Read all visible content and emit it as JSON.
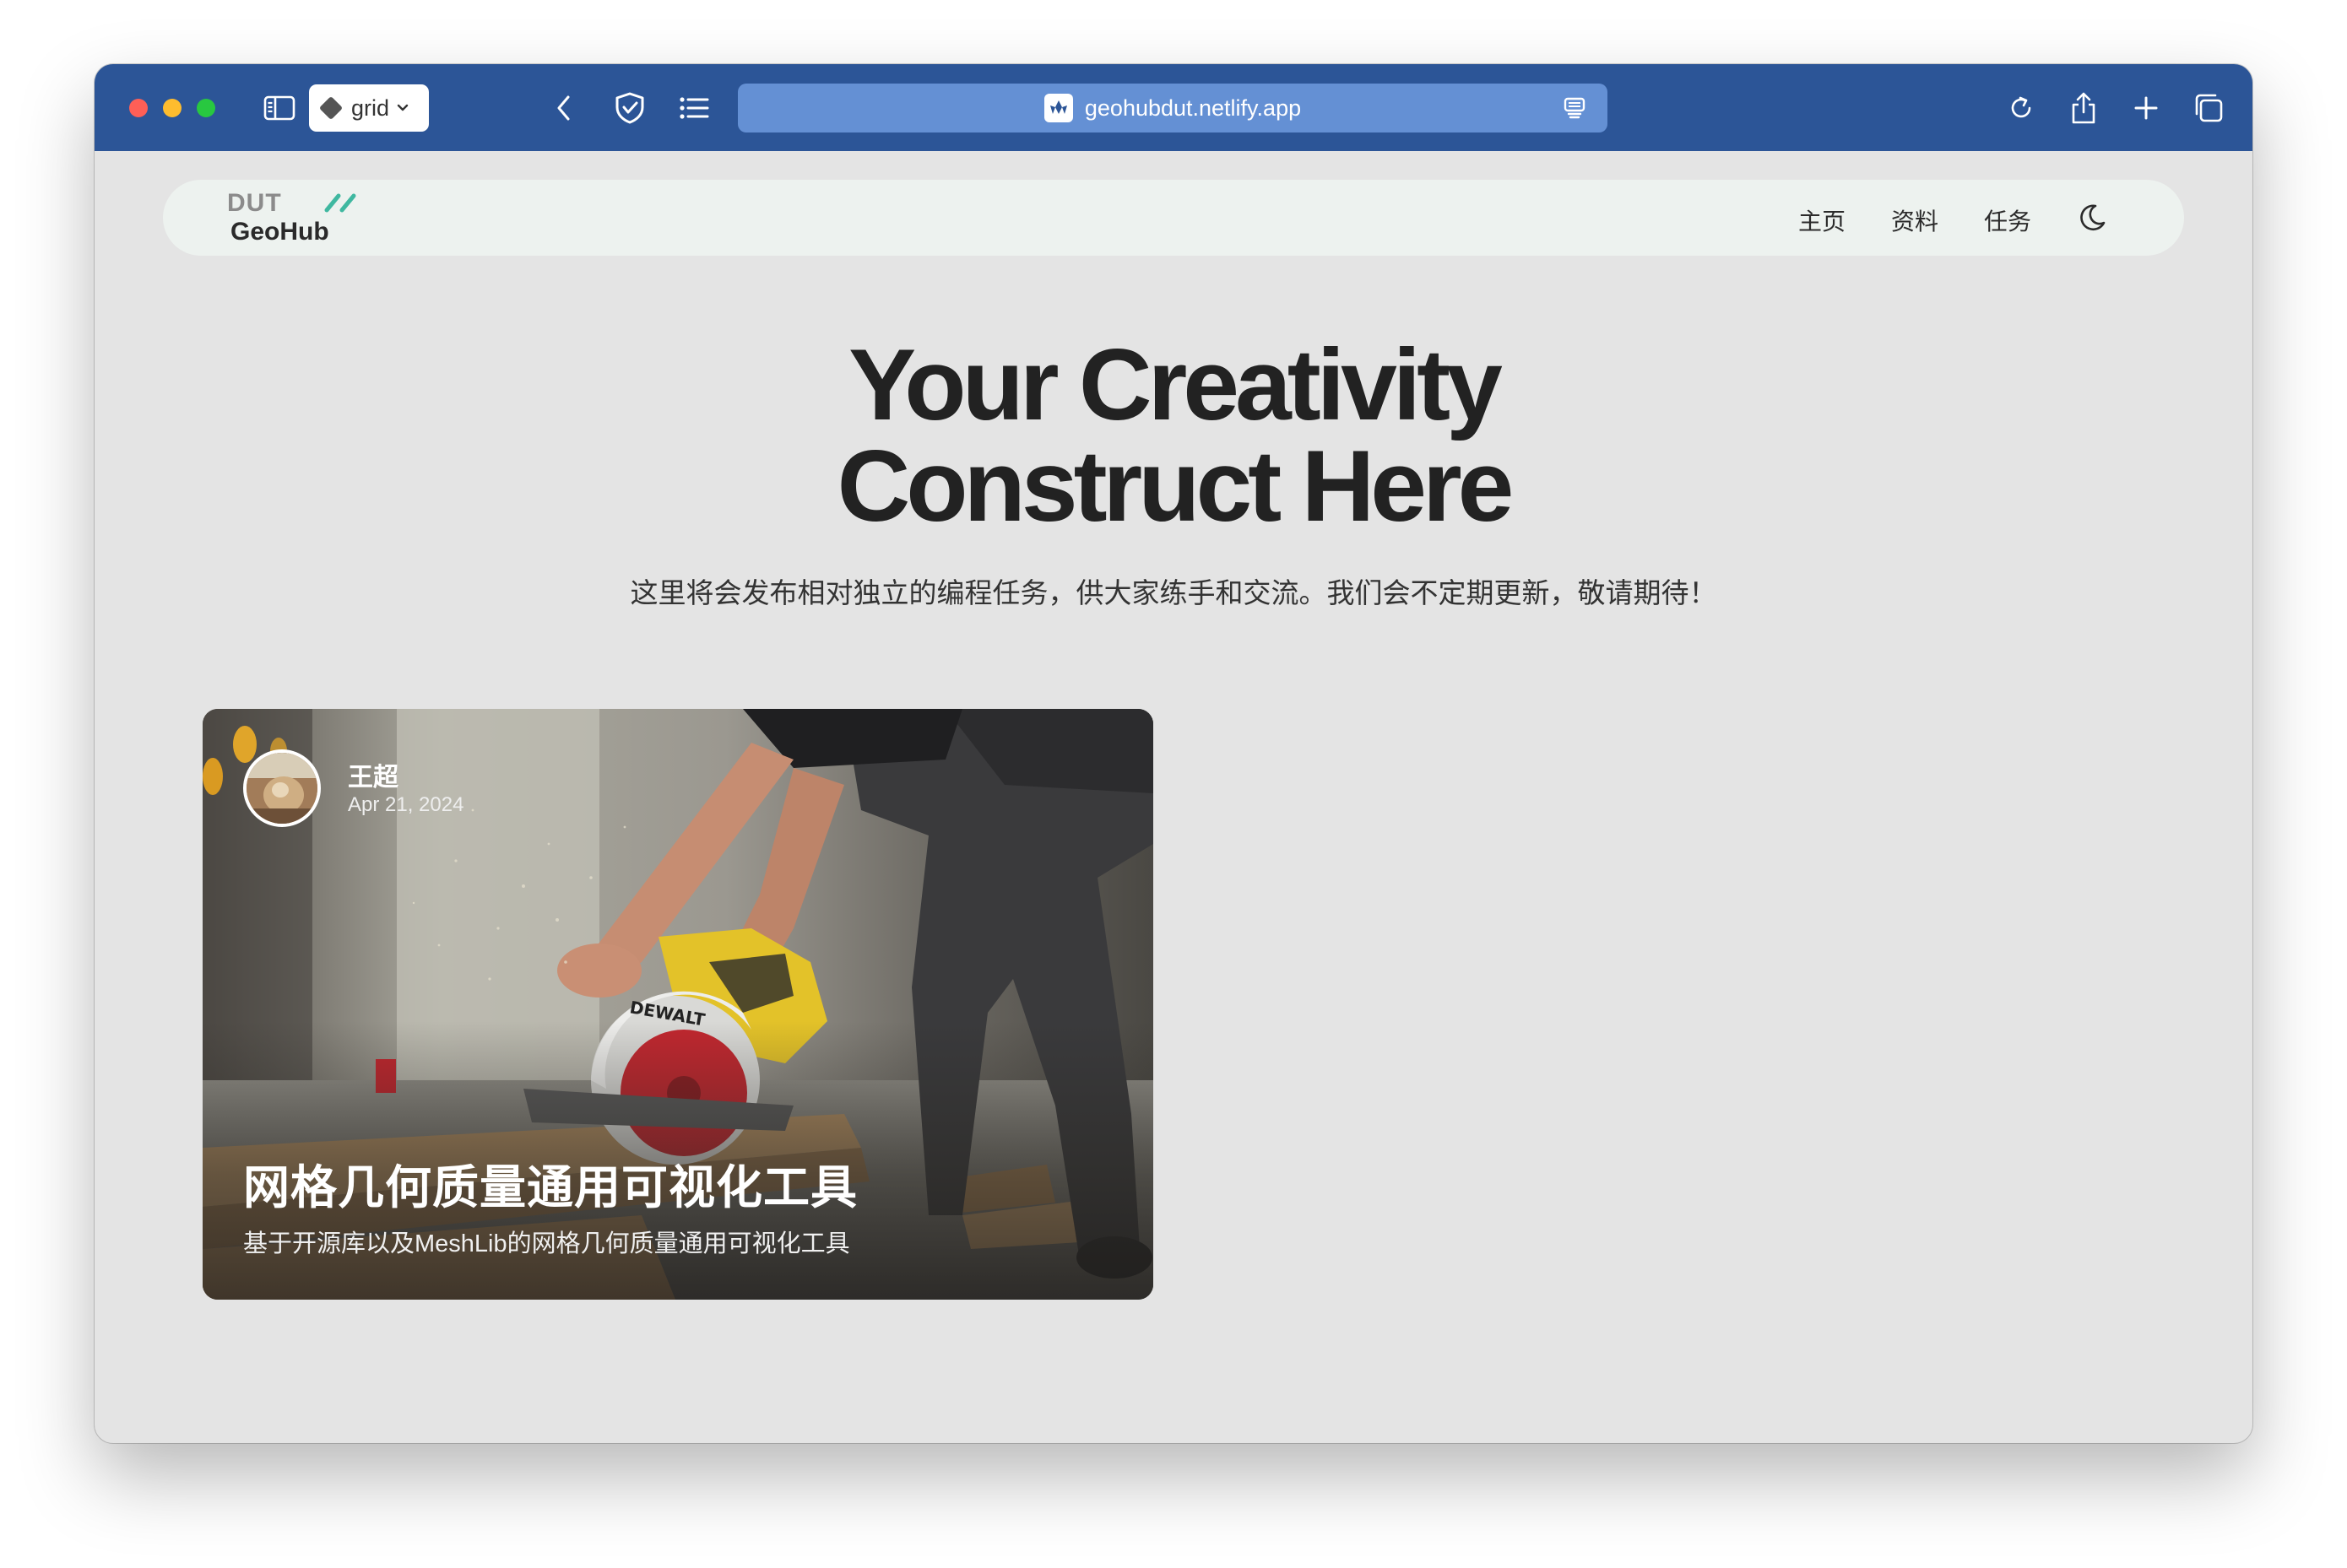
{
  "browser": {
    "profile_label": "grid",
    "url": "geohubdut.netlify.app",
    "toolbar_color": "#2c5597",
    "url_bar_color": "#6490d4"
  },
  "site": {
    "logo_top": "DUT",
    "logo_bottom": "GeoHub",
    "logo_accent_color": "#3fb8a0",
    "nav": [
      "主页",
      "资料",
      "任务"
    ],
    "theme_toggle_icon": "moon-icon"
  },
  "hero": {
    "title_line1": "Your Creativity",
    "title_line2": "Construct Here",
    "subtitle": "这里将会发布相对独立的编程任务，供大家练手和交流。我们会不定期更新，敬请期待！"
  },
  "card": {
    "author": "王超",
    "date": "Apr 21, 2024",
    "title": "网格几何质量通用可视化工具",
    "description": "基于开源库以及MeshLib的网格几何质量通用可视化工具",
    "saw_brand": "DEWALT"
  }
}
